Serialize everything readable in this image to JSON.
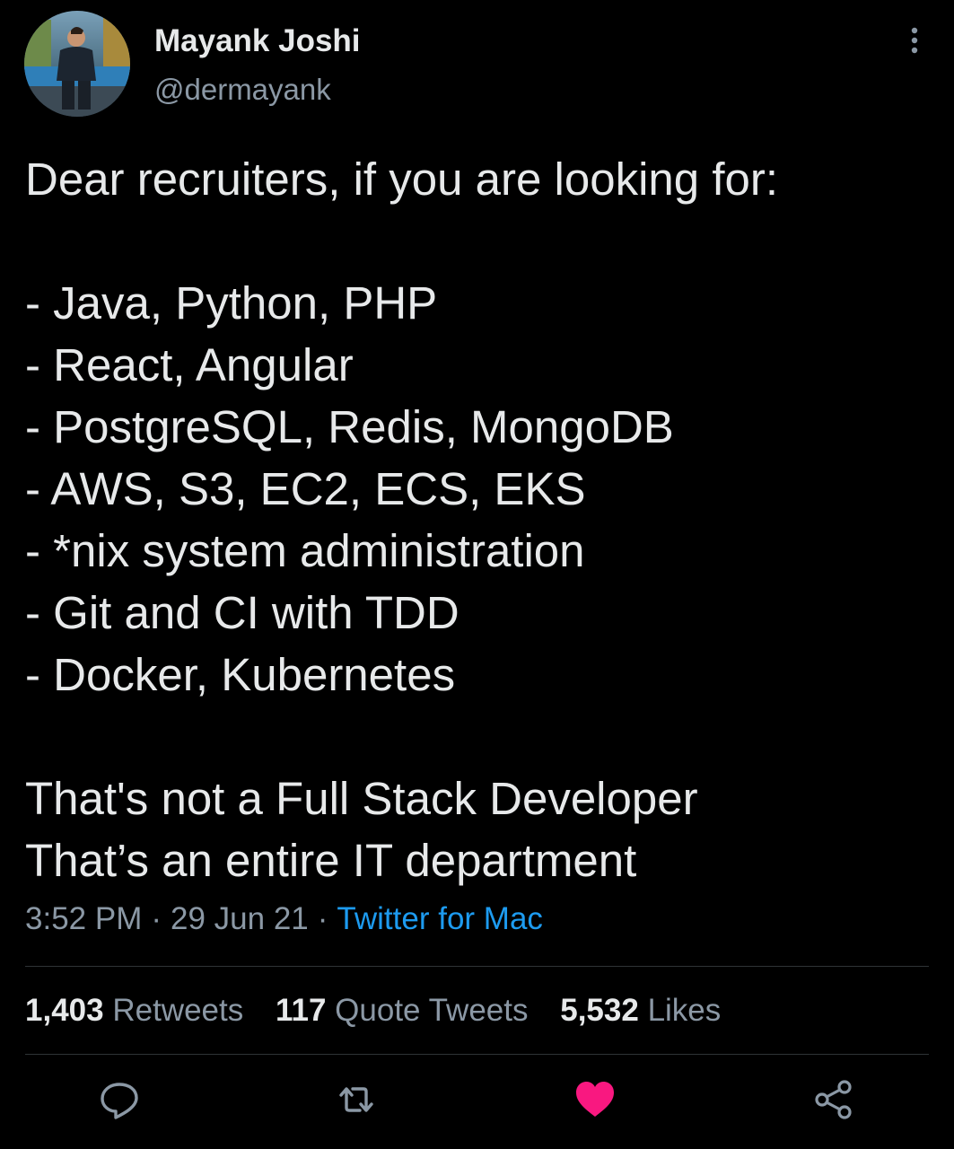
{
  "author": {
    "display_name": "Mayank Joshi",
    "handle": "@dermayank",
    "avatar_icon": "profile-photo"
  },
  "tweet": {
    "lines": [
      "Dear recruiters, if you are looking for:",
      "",
      "- Java, Python, PHP",
      "- React, Angular",
      "- PostgreSQL, Redis, MongoDB",
      "- AWS, S3, EC2, ECS, EKS",
      "- *nix system administration",
      "- Git and CI with TDD",
      "- Docker, Kubernetes",
      "",
      "That's not a Full Stack Developer",
      "That’s an entire IT department"
    ]
  },
  "meta": {
    "time": "3:52 PM",
    "separator": "·",
    "date": "29 Jun 21",
    "source": "Twitter for Mac"
  },
  "stats": {
    "retweets": {
      "count": "1,403",
      "label": "Retweets"
    },
    "quotes": {
      "count": "117",
      "label": "Quote Tweets"
    },
    "likes": {
      "count": "5,532",
      "label": "Likes"
    }
  },
  "actions": {
    "reply_icon": "reply-icon",
    "retweet_icon": "retweet-icon",
    "like_icon": "heart-icon",
    "share_icon": "share-icon",
    "like_active": true
  },
  "colors": {
    "background": "#000000",
    "text": "#e7e9ea",
    "secondary": "#8b98a5",
    "link": "#1d9bf0",
    "like": "#f91880",
    "divider": "#2f3336"
  }
}
